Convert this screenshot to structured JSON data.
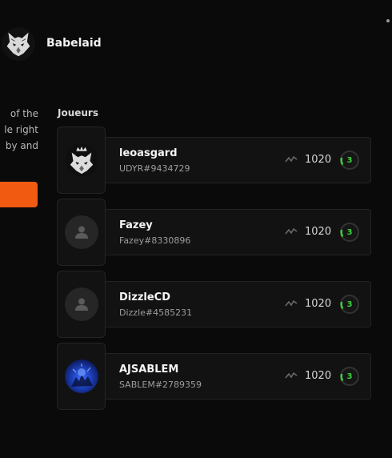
{
  "team": {
    "name": "Babelaid",
    "logo_icon": "wolf-icon"
  },
  "side_text": {
    "lines": [
      "of the",
      "le right",
      "by and"
    ],
    "accent_color": "#f05a11"
  },
  "players_section": {
    "title": "Joueurs",
    "players": [
      {
        "name": "leoasgard",
        "tag": "UDYR#9434729",
        "elo": "1020",
        "level": "3",
        "avatar": "wolf-king-icon"
      },
      {
        "name": "Fazey",
        "tag": "Fazey#8330896",
        "elo": "1020",
        "level": "3",
        "avatar": "default-user-icon"
      },
      {
        "name": "DizzleCD",
        "tag": "Dizzle#4585231",
        "elo": "1020",
        "level": "3",
        "avatar": "default-user-icon"
      },
      {
        "name": "AJSABLEM",
        "tag": "SABLEM#2789359",
        "elo": "1020",
        "level": "3",
        "avatar": "user-photo"
      }
    ],
    "level_color": "#38d438"
  }
}
